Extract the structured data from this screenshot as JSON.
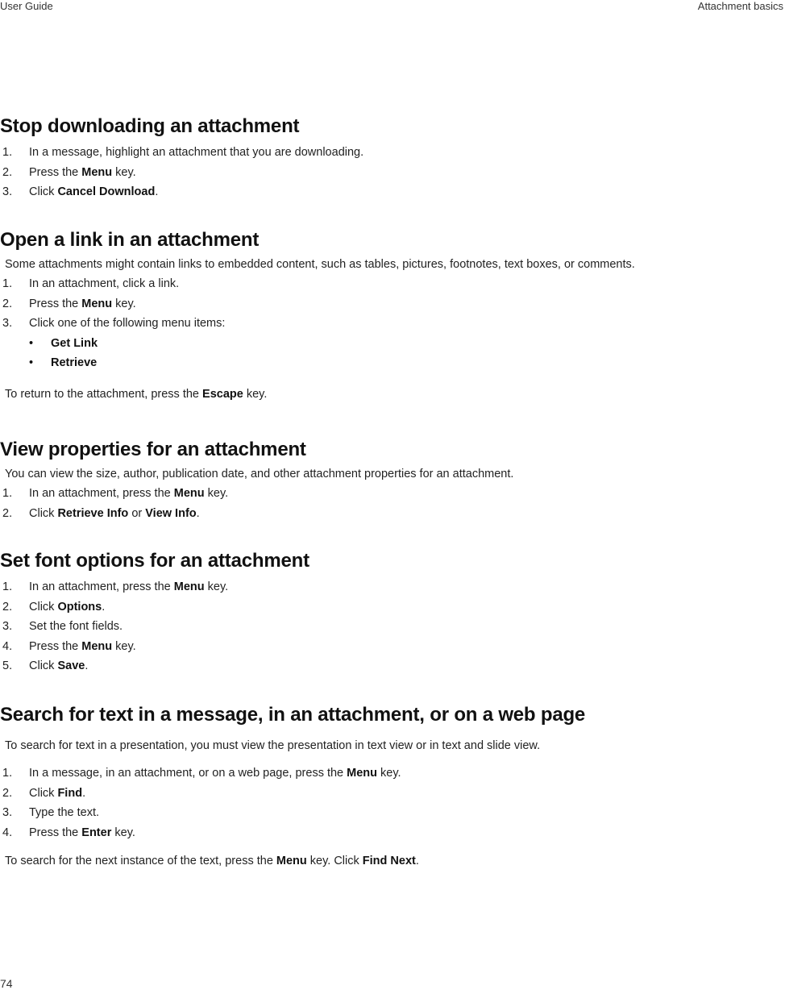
{
  "header": {
    "left": "User Guide",
    "right": "Attachment basics"
  },
  "footer": {
    "page_number": "74"
  },
  "sections": [
    {
      "title": "Stop downloading an attachment",
      "steps": [
        {
          "num": "1.",
          "pre": "In a message, highlight an attachment that you are downloading.",
          "b1": "",
          "mid": "",
          "b2": "",
          "post": ""
        },
        {
          "num": "2.",
          "pre": "Press the ",
          "b1": "Menu",
          "mid": " key.",
          "b2": "",
          "post": ""
        },
        {
          "num": "3.",
          "pre": "Click ",
          "b1": "Cancel Download",
          "mid": ".",
          "b2": "",
          "post": ""
        }
      ]
    },
    {
      "title": "Open a link in an attachment",
      "intro": "Some attachments might contain links to embedded content, such as tables, pictures, footnotes, text boxes, or comments.",
      "steps": [
        {
          "num": "1.",
          "pre": "In an attachment, click a link.",
          "b1": "",
          "mid": "",
          "b2": "",
          "post": ""
        },
        {
          "num": "2.",
          "pre": "Press the ",
          "b1": "Menu",
          "mid": " key.",
          "b2": "",
          "post": ""
        },
        {
          "num": "3.",
          "pre": "Click one of the following menu items:",
          "b1": "",
          "mid": "",
          "b2": "",
          "post": ""
        }
      ],
      "bullets": [
        "Get Link",
        "Retrieve"
      ],
      "note": {
        "pre": "To return to the attachment, press the ",
        "b": "Escape",
        "post": " key."
      }
    },
    {
      "title": "View properties for an attachment",
      "intro": "You can view the size, author, publication date, and other attachment properties for an attachment.",
      "steps": [
        {
          "num": "1.",
          "pre": "In an attachment, press the ",
          "b1": "Menu",
          "mid": " key.",
          "b2": "",
          "post": ""
        },
        {
          "num": "2.",
          "pre": "Click ",
          "b1": "Retrieve Info",
          "mid": " or ",
          "b2": "View Info",
          "post": "."
        }
      ]
    },
    {
      "title": "Set font options for an attachment",
      "steps": [
        {
          "num": "1.",
          "pre": "In an attachment, press the ",
          "b1": "Menu",
          "mid": " key.",
          "b2": "",
          "post": ""
        },
        {
          "num": "2.",
          "pre": "Click ",
          "b1": "Options",
          "mid": ".",
          "b2": "",
          "post": ""
        },
        {
          "num": "3.",
          "pre": "Set the font fields.",
          "b1": "",
          "mid": "",
          "b2": "",
          "post": ""
        },
        {
          "num": "4.",
          "pre": "Press the ",
          "b1": "Menu",
          "mid": " key.",
          "b2": "",
          "post": ""
        },
        {
          "num": "5.",
          "pre": "Click ",
          "b1": "Save",
          "mid": ".",
          "b2": "",
          "post": ""
        }
      ]
    },
    {
      "title": "Search for text in a message, in an attachment, or on a web page",
      "intro": "To search for text in a presentation, you must view the presentation in text view or in text and slide view.",
      "steps": [
        {
          "num": "1.",
          "pre": "In a message, in an attachment, or on a web page, press the ",
          "b1": "Menu",
          "mid": " key.",
          "b2": "",
          "post": ""
        },
        {
          "num": "2.",
          "pre": "Click ",
          "b1": "Find",
          "mid": ".",
          "b2": "",
          "post": ""
        },
        {
          "num": "3.",
          "pre": "Type the text.",
          "b1": "",
          "mid": "",
          "b2": "",
          "post": ""
        },
        {
          "num": "4.",
          "pre": "Press the ",
          "b1": "Enter",
          "mid": " key.",
          "b2": "",
          "post": ""
        }
      ],
      "note": {
        "pre": "To search for the next instance of the text, press the ",
        "b": "Menu",
        "mid": " key. Click ",
        "b2": "Find Next",
        "post": "."
      }
    }
  ]
}
